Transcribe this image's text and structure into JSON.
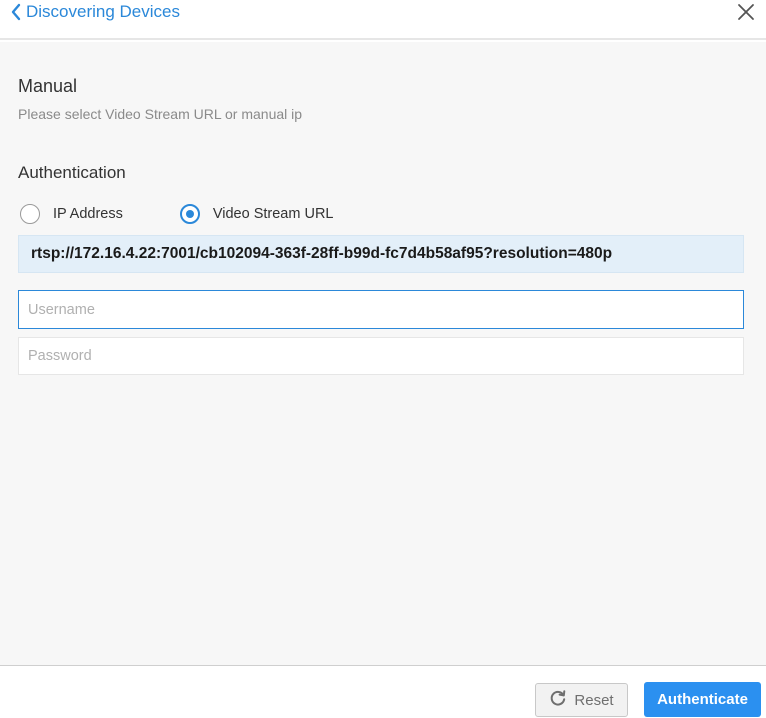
{
  "header": {
    "back_label": "Discovering Devices",
    "back_icon": "chevron-left-icon",
    "close_icon": "close-icon"
  },
  "manual": {
    "title": "Manual",
    "subtitle": "Please select Video Stream URL or manual ip"
  },
  "authentication": {
    "title": "Authentication",
    "options": [
      {
        "label": "IP Address",
        "checked": false
      },
      {
        "label": "Video Stream URL",
        "checked": true
      }
    ],
    "stream_url": "rtsp://172.16.4.22:7001/cb102094-363f-28ff-b99d-fc7d4b58af95?resolution=480p",
    "username_placeholder": "Username",
    "username_value": "",
    "password_placeholder": "Password",
    "password_value": ""
  },
  "footer": {
    "reset_label": "Reset",
    "reset_icon": "refresh-icon",
    "authenticate_label": "Authenticate"
  },
  "colors": {
    "accent": "#2b88d9",
    "primary_button": "#2b90f0",
    "url_background": "#e3eff9",
    "content_background": "#f7f7f7"
  }
}
